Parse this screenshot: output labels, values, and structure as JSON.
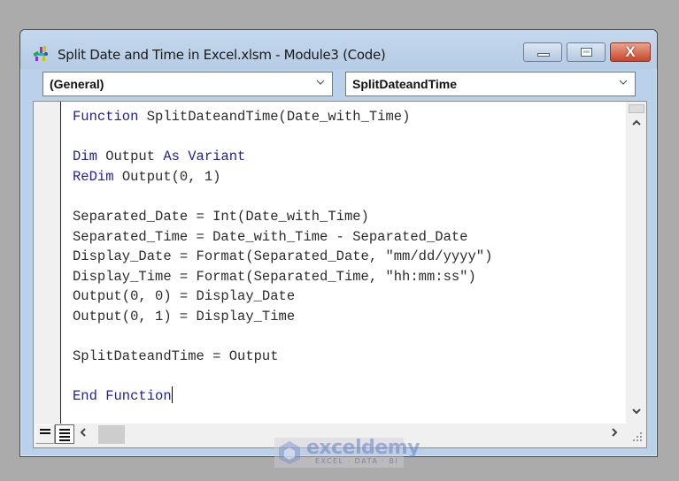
{
  "window": {
    "title": "Split Date and Time in Excel.xlsm - Module3 (Code)",
    "icon": "vba-project-icon",
    "buttons": {
      "minimize": "minimize-icon",
      "maximize": "maximize-icon",
      "close_label": "X"
    }
  },
  "object_combo": {
    "value": "(General)"
  },
  "procedure_combo": {
    "value": "SplitDateandTime"
  },
  "code_lines": [
    {
      "text": "Function SplitDateandTime(Date_with_Time)",
      "keyword": "Function"
    },
    {
      "text": ""
    },
    {
      "text": "Dim Output As Variant",
      "keyword": "Dim",
      "keyword2": "As",
      "rest_mid": " Output ",
      "rest_end": " Variant"
    },
    {
      "text": "ReDim Output(0, 1)",
      "keyword": "ReDim"
    },
    {
      "text": ""
    },
    {
      "text": "Separated_Date = Int(Date_with_Time)"
    },
    {
      "text": "Separated_Time = Date_with_Time - Separated_Date"
    },
    {
      "text": "Display_Date = Format(Separated_Date, \"mm/dd/yyyy\")"
    },
    {
      "text": "Display_Time = Format(Separated_Time, \"hh:mm:ss\")"
    },
    {
      "text": "Output(0, 0) = Display_Date"
    },
    {
      "text": "Output(0, 1) = Display_Time"
    },
    {
      "text": ""
    },
    {
      "text": "SplitDateandTime = Output"
    },
    {
      "text": ""
    },
    {
      "text": "End Function",
      "keyword": "End Function"
    }
  ],
  "code": {
    "l1_kw": "Function",
    "l1_rest": " SplitDateandTime(Date_with_Time)",
    "l3_kw1": "Dim",
    "l3_mid": " Output ",
    "l3_kw2": "As",
    "l3_sp": " ",
    "l3_kw3": "Variant",
    "l4_kw": "ReDim",
    "l4_rest": " Output(0, 1)",
    "l6": "Separated_Date = Int(Date_with_Time)",
    "l7": "Separated_Time = Date_with_Time - Separated_Date",
    "l8": "Display_Date = Format(Separated_Date, \"mm/dd/yyyy\")",
    "l9": "Display_Time = Format(Separated_Time, \"hh:mm:ss\")",
    "l10": "Output(0, 0) = Display_Date",
    "l11": "Output(0, 1) = Display_Time",
    "l13": "SplitDateandTime = Output",
    "l15_kw": "End Function"
  },
  "scroll": {
    "up": "^",
    "down": "v",
    "left": "<",
    "right": ">"
  },
  "watermark": {
    "name": "exceldemy",
    "tagline": "EXCEL · DATA · BI"
  },
  "colors": {
    "keyword": "#1f1fa0",
    "text": "#2b2b2b",
    "titlebar": "#b9d1ea",
    "close": "#c9452b"
  }
}
